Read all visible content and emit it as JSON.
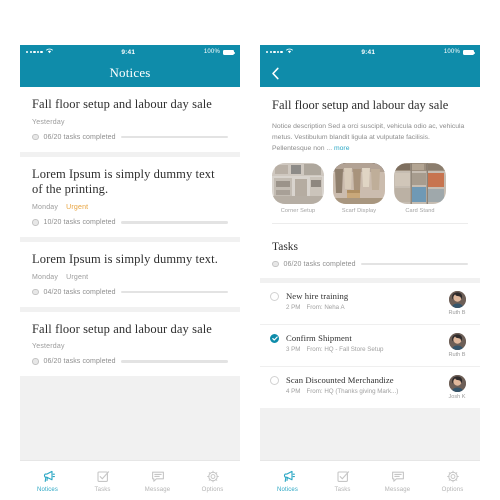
{
  "theme": {
    "teal": "#0f8caa",
    "teal_light": "#2aa7c4",
    "orange": "#e8a33d",
    "progress_start": "#b5cc33",
    "progress_end": "#1b9aa8",
    "page_bg": "#f1f1f1",
    "card_bg": "#ffffff"
  },
  "status_bar": {
    "signal_dots": 5,
    "wifi_icon": "wifi-icon",
    "time": "9:41",
    "battery_percent": "100%",
    "battery_icon": "battery-full-icon"
  },
  "screen_list": {
    "nav": {
      "title": "Notices"
    },
    "notices": [
      {
        "title": "Fall floor setup and labour day sale",
        "day": "Yesterday",
        "flag": "",
        "flag_urgent": false,
        "progress_label": "06/20 tasks completed",
        "completed": 6,
        "total": 20
      },
      {
        "title": "Lorem Ipsum is simply dummy text of the printing.",
        "day": "Monday",
        "flag": "Urgent",
        "flag_urgent": true,
        "progress_label": "10/20 tasks completed",
        "completed": 10,
        "total": 20
      },
      {
        "title": "Lorem Ipsum is simply dummy text.",
        "day": "Monday",
        "flag": "Urgent",
        "flag_urgent": false,
        "progress_label": "04/20 tasks completed",
        "completed": 4,
        "total": 20
      },
      {
        "title": "Fall floor setup and labour day sale",
        "day": "Yesterday",
        "flag": "",
        "flag_urgent": false,
        "progress_label": "06/20 tasks completed",
        "completed": 6,
        "total": 20
      }
    ],
    "tabs": [
      {
        "label": "Notices",
        "icon": "megaphone-icon",
        "active": true
      },
      {
        "label": "Tasks",
        "icon": "checkbox-check-icon",
        "active": false
      },
      {
        "label": "Message",
        "icon": "message-bubble-icon",
        "active": false
      },
      {
        "label": "Options",
        "icon": "gear-icon",
        "active": false
      }
    ]
  },
  "screen_detail": {
    "nav": {
      "back_icon": "chevron-left-icon"
    },
    "notice": {
      "title": "Fall floor setup and labour day sale",
      "description": "Notice description Sed a orci suscipit, vehicula odio ac, vehicula metus. Vestibulum blandit ligula at vulputate facilisis. Pellentesque non ...",
      "more_label": "more"
    },
    "thumbnails": [
      {
        "caption": "Corner Setup"
      },
      {
        "caption": "Scarf Display"
      },
      {
        "caption": "Card Stand"
      }
    ],
    "tasks_section": {
      "heading": "Tasks",
      "progress_label": "06/20 tasks completed",
      "completed": 6,
      "total": 20
    },
    "tasks": [
      {
        "name": "New hire training",
        "time": "2 PM",
        "from": "From: Neha A",
        "done": false,
        "assignee": "Ruth B"
      },
      {
        "name": "Confirm Shipment",
        "time": "3 PM",
        "from": "From: HQ - Fall Store Setup",
        "done": true,
        "assignee": "Ruth B"
      },
      {
        "name": "Scan Discounted Merchandize",
        "time": "4 PM",
        "from": "From: HQ (Thanks giving Mark...)",
        "done": false,
        "assignee": "Josh K"
      }
    ],
    "tabs": [
      {
        "label": "Notices",
        "icon": "megaphone-icon",
        "active": true
      },
      {
        "label": "Tasks",
        "icon": "checkbox-check-icon",
        "active": false
      },
      {
        "label": "Message",
        "icon": "message-bubble-icon",
        "active": false
      },
      {
        "label": "Options",
        "icon": "gear-icon",
        "active": false
      }
    ]
  }
}
